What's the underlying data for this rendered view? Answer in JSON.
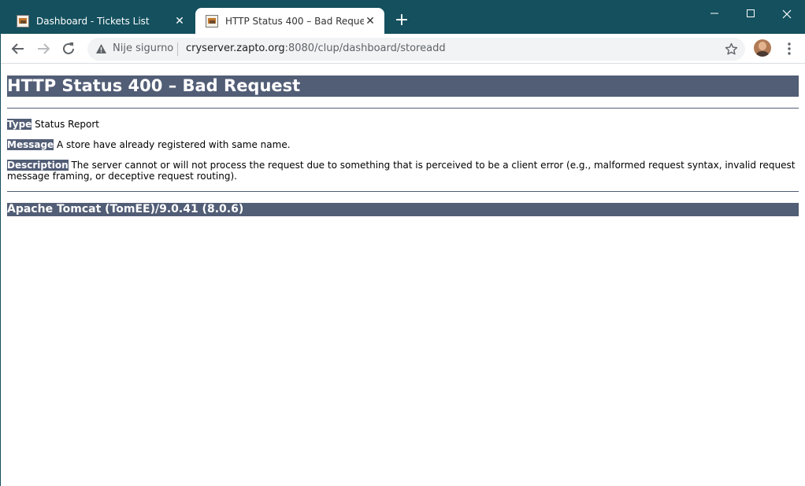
{
  "browser": {
    "tabs": [
      {
        "title": "Dashboard - Tickets List",
        "active": false
      },
      {
        "title": "HTTP Status 400 – Bad Request",
        "active": true
      }
    ],
    "address_bar": {
      "security_label": "Nije sigurno",
      "url_host": "cryserver.zapto.org",
      "url_rest": ":8080/clup/dashboard/storeadd"
    }
  },
  "page": {
    "heading": "HTTP Status 400 – Bad Request",
    "type_label": "Type",
    "type_value": " Status Report",
    "message_label": "Message",
    "message_value": " A store have already registered with same name.",
    "description_label": "Description",
    "description_value": " The server cannot or will not process the request due to something that is perceived to be a client error (e.g., malformed request syntax, invalid request message framing, or deceptive request routing).",
    "server_info": "Apache Tomcat (TomEE)/9.0.41 (8.0.6)"
  },
  "colors": {
    "frame": "#14505e",
    "tomcat_header": "#525d76"
  }
}
